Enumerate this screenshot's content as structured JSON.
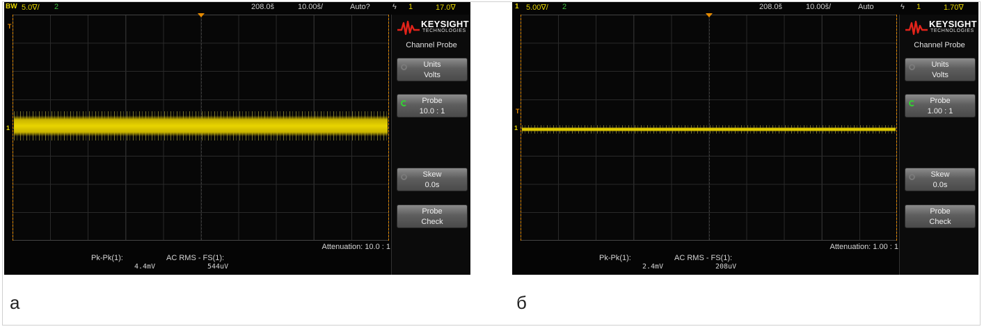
{
  "scopes": [
    {
      "caption": "а",
      "status": {
        "channel_badge": "BW",
        "volts_div": "5.0∇/",
        "ch2": "2",
        "time_offset": "208.0š",
        "time_div": "10.00š/",
        "trigger_mode": "Auto?",
        "trigger_icon": "ϟ",
        "trigger_ch": "1",
        "trigger_level": "17.0∇"
      },
      "logo": {
        "name": "KEYSIGHT",
        "sub": "TECHNOLOGIES"
      },
      "menu_title": "Channel Probe",
      "softkeys": {
        "units_label": "Units",
        "units_value": "Volts",
        "probe_label": "Probe",
        "probe_value": "10.0 : 1",
        "skew_label": "Skew",
        "skew_value": "0.0s",
        "check_label": "Probe",
        "check_value": "Check"
      },
      "attenuation": "Attenuation: 10.0 : 1",
      "measurements": {
        "m1_label": "Pk-Pk(1):",
        "m1_value": "4.4mV",
        "m2_label": "AC RMS - FS(1):",
        "m2_value": "544uV"
      },
      "trace_color": "#e5d400"
    },
    {
      "caption": "б",
      "status": {
        "channel_badge": "1",
        "volts_div": "5.00∇/",
        "ch2": "2",
        "time_offset": "208.0š",
        "time_div": "10.00š/",
        "trigger_mode": "Auto",
        "trigger_icon": "ϟ",
        "trigger_ch": "1",
        "trigger_level": "1.70∇"
      },
      "logo": {
        "name": "KEYSIGHT",
        "sub": "TECHNOLOGIES"
      },
      "menu_title": "Channel Probe",
      "softkeys": {
        "units_label": "Units",
        "units_value": "Volts",
        "probe_label": "Probe",
        "probe_value": "1.00 : 1",
        "skew_label": "Skew",
        "skew_value": "0.0s",
        "check_label": "Probe",
        "check_value": "Check"
      },
      "attenuation": "Attenuation: 1.00 : 1",
      "measurements": {
        "m1_label": "Pk-Pk(1):",
        "m1_value": "2.4mV",
        "m2_label": "AC RMS - FS(1):",
        "m2_value": "208uV"
      },
      "trace_color": "#e5d400"
    }
  ],
  "markers": {
    "trigger": "T",
    "channel": "1"
  },
  "accent_orange": "#e58a00",
  "softkey_active_color": "#34d034"
}
